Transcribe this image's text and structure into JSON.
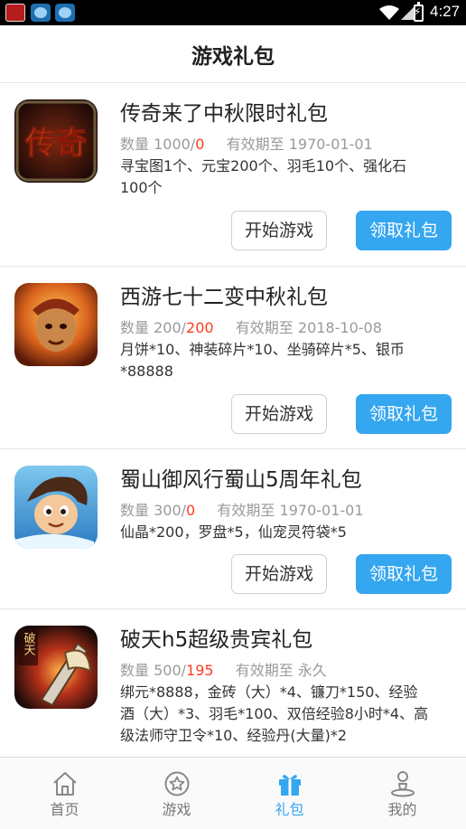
{
  "status_bar": {
    "time": "4:27"
  },
  "header": {
    "title": "游戏礼包"
  },
  "gifts": [
    {
      "title": "传奇来了中秋限时礼包",
      "quantity_label": "数量",
      "total": "1000",
      "remaining": "0",
      "expiry_label": "有效期至",
      "expiry": "1970-01-01",
      "description": "寻宝图1个、元宝200个、羽毛10个、强化石100个",
      "start_label": "开始游戏",
      "claim_label": "领取礼包",
      "icon_text": "传奇"
    },
    {
      "title": "西游七十二变中秋礼包",
      "quantity_label": "数量",
      "total": "200",
      "remaining": "200",
      "expiry_label": "有效期至",
      "expiry": "2018-10-08",
      "description": "月饼*10、神装碎片*10、坐骑碎片*5、银币*88888",
      "start_label": "开始游戏",
      "claim_label": "领取礼包"
    },
    {
      "title": "蜀山御风行蜀山5周年礼包",
      "quantity_label": "数量",
      "total": "300",
      "remaining": "0",
      "expiry_label": "有效期至",
      "expiry": "1970-01-01",
      "description": "仙晶*200，罗盘*5，仙宠灵符袋*5",
      "start_label": "开始游戏",
      "claim_label": "领取礼包"
    },
    {
      "title": "破天h5超级贵宾礼包",
      "quantity_label": "数量",
      "total": "500",
      "remaining": "195",
      "expiry_label": "有效期至",
      "expiry": "永久",
      "description": "绑元*8888，金砖（大）*4、镰刀*150、经验酒（大）*3、羽毛*100、双倍经验8小时*4、高级法师守卫令*10、经验丹(大量)*2",
      "icon_text": "破天"
    }
  ],
  "tabbar": {
    "items": [
      {
        "label": "首页",
        "icon": "home-icon"
      },
      {
        "label": "游戏",
        "icon": "star-icon"
      },
      {
        "label": "礼包",
        "icon": "gift-icon",
        "active": true
      },
      {
        "label": "我的",
        "icon": "user-icon"
      }
    ]
  },
  "colors": {
    "accent": "#35a6f0",
    "highlight": "#ff3b1f",
    "muted_text": "#9a9a9a"
  }
}
